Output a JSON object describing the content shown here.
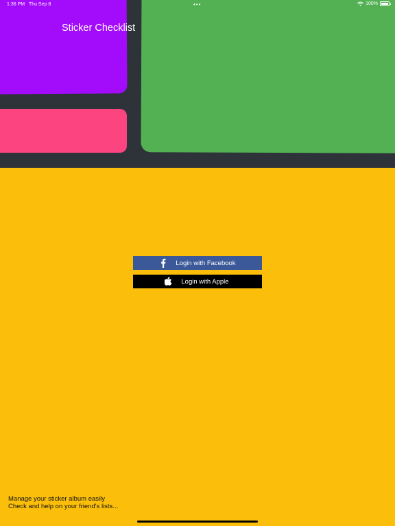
{
  "status_bar": {
    "time": "1:36 PM",
    "date": "Thu Sep 8",
    "battery_percent": "100%",
    "icons": [
      "wifi-icon",
      "battery-icon"
    ]
  },
  "app": {
    "title": "Sticker Checklist"
  },
  "login": {
    "facebook_label": "Login with Facebook",
    "apple_label": "Login with Apple"
  },
  "footer": {
    "line1": "Manage your sticker album easily",
    "line2": "Check and help on your friend's lists..."
  },
  "colors": {
    "background": "#FBBF0B",
    "hero_background": "#2E333A",
    "tile_purple": "#A30BFB",
    "tile_pink": "#FB4480",
    "tile_green": "#53B154",
    "facebook_blue": "#3B5998",
    "apple_black": "#000000"
  }
}
